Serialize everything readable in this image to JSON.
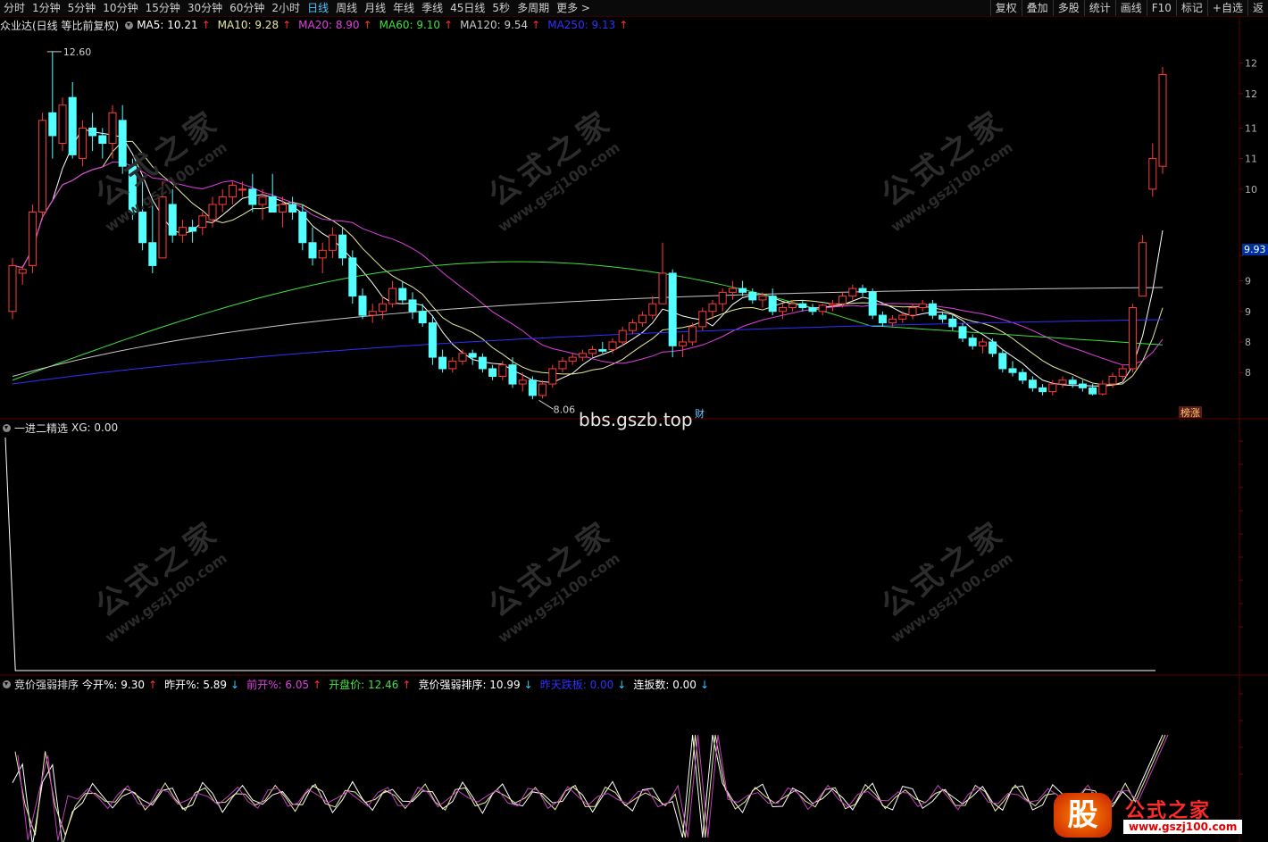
{
  "toolbar": {
    "periods": [
      "分时",
      "1分钟",
      "5分钟",
      "10分钟",
      "15分钟",
      "30分钟",
      "60分钟",
      "2小时",
      "日线",
      "周线",
      "月线",
      "年线",
      "季线",
      "45日线",
      "5秒",
      "多周期",
      "更多 >"
    ],
    "active_period": "日线",
    "buttons": [
      "复权",
      "叠加",
      "多股",
      "统计",
      "画线",
      "F10",
      "标记",
      "+自选",
      "返"
    ]
  },
  "main_legend": {
    "stock": "众业达(日线 等比前复权)",
    "ma": [
      {
        "label": "MA5: 10.21",
        "color": "#ffffff",
        "arrow": "↑"
      },
      {
        "label": "MA10: 9.28",
        "color": "#e8e8a0",
        "arrow": "↑"
      },
      {
        "label": "MA20: 8.90",
        "color": "#e040e0",
        "arrow": "↑"
      },
      {
        "label": "MA60: 9.10",
        "color": "#40e040",
        "arrow": "↑"
      },
      {
        "label": "MA120: 9.54",
        "color": "#c8c8c8",
        "arrow": "↑"
      },
      {
        "label": "MA250: 9.13",
        "color": "#3030ff",
        "arrow": "↑"
      }
    ]
  },
  "ind1_legend": {
    "name": "一进二精选",
    "value": "XG: 0.00"
  },
  "ind2_legend": {
    "name": "竞价强弱排序",
    "items": [
      {
        "label": "今开%: 9.30",
        "color": "#ffffff",
        "arrow": "↑"
      },
      {
        "label": "昨开%: 5.89",
        "color": "#ffffff",
        "arrow": "↓"
      },
      {
        "label": "前开%: 6.05",
        "color": "#e040e0",
        "arrow": "↑"
      },
      {
        "label": "开盘价: 12.46",
        "color": "#40e040",
        "arrow": "↑"
      },
      {
        "label": "竞价强弱排序: 10.99",
        "color": "#ffffff",
        "arrow": "↓"
      },
      {
        "label": "昨天跌板: 0.00",
        "color": "#3030ff",
        "arrow": "↓"
      },
      {
        "label": "连扳数: 0.00",
        "color": "#ffffff",
        "arrow": "↓"
      }
    ]
  },
  "watermark": {
    "text": "公式之家",
    "url": "www.gszj100.com"
  },
  "site": "bbs.gszb.top",
  "logo": {
    "icon": "股",
    "name": "公式之家",
    "url": "www.gszj100.com"
  },
  "price_tag": "9.93",
  "annotations": {
    "high": "12.60",
    "low": "8.06",
    "cai": "财",
    "bangzhang": "榜涨"
  },
  "chart_data": [
    {
      "type": "candlestick",
      "axis_ticks": [
        "12",
        "12",
        "11",
        "11",
        "10",
        "9.93",
        "9",
        "9",
        "8",
        "8"
      ],
      "high_label": "12.60",
      "low_label": "8.06",
      "ohlc": [
        [
          9.2,
          9.9,
          9.1,
          9.8
        ],
        [
          9.7,
          9.8,
          9.55,
          9.75
        ],
        [
          9.8,
          10.6,
          9.7,
          10.5
        ],
        [
          10.5,
          11.8,
          10.4,
          11.7
        ],
        [
          11.8,
          12.6,
          11.2,
          11.5
        ],
        [
          11.4,
          12.0,
          11.3,
          11.9
        ],
        [
          12.0,
          12.2,
          11.2,
          11.25
        ],
        [
          11.2,
          11.7,
          11.1,
          11.6
        ],
        [
          11.6,
          11.8,
          11.3,
          11.5
        ],
        [
          11.5,
          11.6,
          11.2,
          11.4
        ],
        [
          11.4,
          11.9,
          11.2,
          11.8
        ],
        [
          11.7,
          11.9,
          11.0,
          11.1
        ],
        [
          11.1,
          11.2,
          10.4,
          10.5
        ],
        [
          10.5,
          10.9,
          10.0,
          10.1
        ],
        [
          10.1,
          10.6,
          9.7,
          9.8
        ],
        [
          9.9,
          10.9,
          9.9,
          10.7
        ],
        [
          10.6,
          10.8,
          10.1,
          10.2
        ],
        [
          10.2,
          10.4,
          10.1,
          10.3
        ],
        [
          10.3,
          10.4,
          10.1,
          10.25
        ],
        [
          10.3,
          10.5,
          10.2,
          10.45
        ],
        [
          10.4,
          10.7,
          10.3,
          10.6
        ],
        [
          10.6,
          10.8,
          10.5,
          10.7
        ],
        [
          10.7,
          10.9,
          10.6,
          10.85
        ],
        [
          10.8,
          10.9,
          10.7,
          10.8
        ],
        [
          10.8,
          11.0,
          10.5,
          10.6
        ],
        [
          10.6,
          10.8,
          10.4,
          10.7
        ],
        [
          10.7,
          11.0,
          10.6,
          10.5
        ],
        [
          10.5,
          10.7,
          10.3,
          10.6
        ],
        [
          10.6,
          10.7,
          10.4,
          10.5
        ],
        [
          10.5,
          10.6,
          10.0,
          10.1
        ],
        [
          10.1,
          10.3,
          9.8,
          9.9
        ],
        [
          9.9,
          10.1,
          9.7,
          10.0
        ],
        [
          10.0,
          10.3,
          9.9,
          10.2
        ],
        [
          10.2,
          10.3,
          9.8,
          9.9
        ],
        [
          9.9,
          10.0,
          9.3,
          9.4
        ],
        [
          9.4,
          9.5,
          9.1,
          9.15
        ],
        [
          9.15,
          9.3,
          9.05,
          9.2
        ],
        [
          9.2,
          9.4,
          9.1,
          9.3
        ],
        [
          9.3,
          9.6,
          9.25,
          9.5
        ],
        [
          9.5,
          9.6,
          9.3,
          9.35
        ],
        [
          9.35,
          9.45,
          9.1,
          9.2
        ],
        [
          9.2,
          9.3,
          9.0,
          9.05
        ],
        [
          9.05,
          9.15,
          8.5,
          8.6
        ],
        [
          8.6,
          8.7,
          8.4,
          8.45
        ],
        [
          8.45,
          8.6,
          8.4,
          8.55
        ],
        [
          8.55,
          8.7,
          8.5,
          8.65
        ],
        [
          8.65,
          8.7,
          8.5,
          8.6
        ],
        [
          8.6,
          8.65,
          8.4,
          8.45
        ],
        [
          8.45,
          8.5,
          8.3,
          8.35
        ],
        [
          8.35,
          8.55,
          8.3,
          8.5
        ],
        [
          8.5,
          8.6,
          8.2,
          8.25
        ],
        [
          8.25,
          8.4,
          8.15,
          8.3
        ],
        [
          8.3,
          8.35,
          8.05,
          8.1
        ],
        [
          8.1,
          8.3,
          8.06,
          8.25
        ],
        [
          8.25,
          8.5,
          8.2,
          8.45
        ],
        [
          8.45,
          8.6,
          8.4,
          8.55
        ],
        [
          8.55,
          8.65,
          8.5,
          8.6
        ],
        [
          8.6,
          8.7,
          8.55,
          8.65
        ],
        [
          8.65,
          8.75,
          8.6,
          8.7
        ],
        [
          8.7,
          8.8,
          8.65,
          8.68
        ],
        [
          8.7,
          8.85,
          8.65,
          8.8
        ],
        [
          8.8,
          9.0,
          8.75,
          8.95
        ],
        [
          8.95,
          9.1,
          8.9,
          9.05
        ],
        [
          9.05,
          9.2,
          9.0,
          9.15
        ],
        [
          9.15,
          9.4,
          9.1,
          9.3
        ],
        [
          9.3,
          10.1,
          9.3,
          9.7
        ],
        [
          9.7,
          9.75,
          8.6,
          8.75
        ],
        [
          8.75,
          8.9,
          8.6,
          8.8
        ],
        [
          8.8,
          9.05,
          8.75,
          9.0
        ],
        [
          9.0,
          9.25,
          8.95,
          9.2
        ],
        [
          9.2,
          9.35,
          9.1,
          9.3
        ],
        [
          9.3,
          9.5,
          9.2,
          9.45
        ],
        [
          9.45,
          9.6,
          9.35,
          9.5
        ],
        [
          9.5,
          9.6,
          9.4,
          9.45
        ],
        [
          9.45,
          9.5,
          9.3,
          9.35
        ],
        [
          9.35,
          9.45,
          9.25,
          9.4
        ],
        [
          9.4,
          9.5,
          9.15,
          9.2
        ],
        [
          9.2,
          9.3,
          9.1,
          9.25
        ],
        [
          9.25,
          9.35,
          9.2,
          9.3
        ],
        [
          9.3,
          9.35,
          9.2,
          9.25
        ],
        [
          9.25,
          9.3,
          9.15,
          9.2
        ],
        [
          9.2,
          9.3,
          9.15,
          9.28
        ],
        [
          9.28,
          9.35,
          9.2,
          9.3
        ],
        [
          9.3,
          9.45,
          9.25,
          9.4
        ],
        [
          9.4,
          9.55,
          9.35,
          9.5
        ],
        [
          9.5,
          9.55,
          9.4,
          9.45
        ],
        [
          9.45,
          9.5,
          9.1,
          9.15
        ],
        [
          9.15,
          9.2,
          9.0,
          9.05
        ],
        [
          9.05,
          9.15,
          9.0,
          9.1
        ],
        [
          9.1,
          9.2,
          9.05,
          9.15
        ],
        [
          9.15,
          9.3,
          9.1,
          9.25
        ],
        [
          9.25,
          9.35,
          9.2,
          9.3
        ],
        [
          9.3,
          9.35,
          9.1,
          9.15
        ],
        [
          9.15,
          9.2,
          9.05,
          9.1
        ],
        [
          9.1,
          9.15,
          8.95,
          9.0
        ],
        [
          9.0,
          9.05,
          8.8,
          8.85
        ],
        [
          8.85,
          8.9,
          8.7,
          8.75
        ],
        [
          8.75,
          8.85,
          8.65,
          8.8
        ],
        [
          8.8,
          8.85,
          8.6,
          8.65
        ],
        [
          8.65,
          8.7,
          8.4,
          8.45
        ],
        [
          8.45,
          8.55,
          8.35,
          8.4
        ],
        [
          8.4,
          8.45,
          8.25,
          8.3
        ],
        [
          8.3,
          8.35,
          8.15,
          8.2
        ],
        [
          8.2,
          8.25,
          8.1,
          8.15
        ],
        [
          8.15,
          8.3,
          8.1,
          8.25
        ],
        [
          8.25,
          8.35,
          8.2,
          8.3
        ],
        [
          8.3,
          8.35,
          8.2,
          8.25
        ],
        [
          8.25,
          8.3,
          8.15,
          8.2
        ],
        [
          8.2,
          8.25,
          8.1,
          8.12
        ],
        [
          8.12,
          8.3,
          8.1,
          8.25
        ],
        [
          8.25,
          8.4,
          8.2,
          8.35
        ],
        [
          8.35,
          8.5,
          8.3,
          8.45
        ],
        [
          8.45,
          9.3,
          8.4,
          9.25
        ],
        [
          9.4,
          10.2,
          9.4,
          10.1
        ],
        [
          10.8,
          11.4,
          10.7,
          11.2
        ],
        [
          11.1,
          12.4,
          11.0,
          12.3
        ]
      ]
    },
    {
      "type": "line",
      "name": "XG",
      "spikes_at": [
        0,
        120
      ],
      "max": 1
    },
    {
      "type": "line",
      "name": "竞价强弱排序",
      "series_count": 3
    }
  ]
}
